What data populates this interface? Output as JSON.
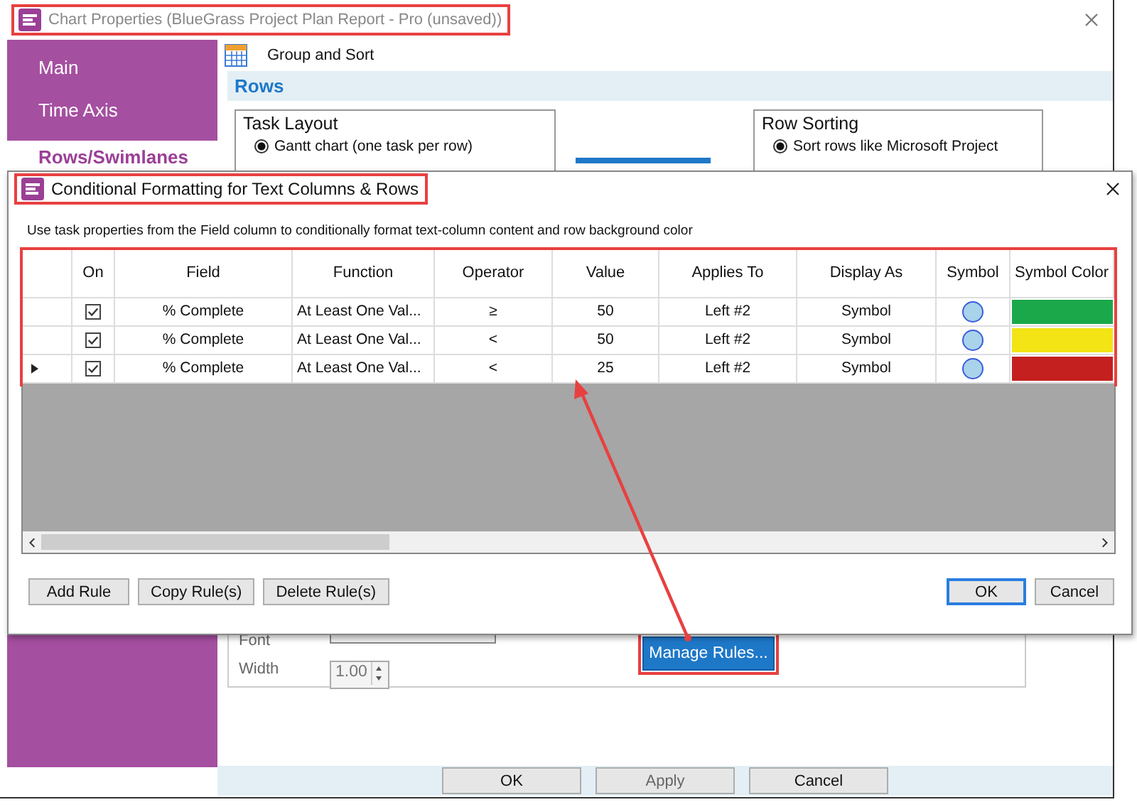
{
  "main_window": {
    "title": "Chart Properties (BlueGrass Project Plan Report - Pro (unsaved))",
    "sidebar": {
      "items": [
        {
          "label": "Main",
          "selected": false
        },
        {
          "label": "Time Axis",
          "selected": false
        },
        {
          "label": "Rows/Swimlanes",
          "selected": true
        }
      ]
    },
    "section_header": "Group and Sort",
    "band": "Rows",
    "task_layout": {
      "title": "Task Layout",
      "options": [
        {
          "label": "Gantt chart (one task per row)",
          "selected": true
        }
      ]
    },
    "row_sorting": {
      "title": "Row Sorting",
      "options": [
        {
          "label": "Sort rows like Microsoft Project",
          "selected": true
        }
      ]
    },
    "font_label": "Font",
    "width_label": "Width",
    "width_value": "1.00",
    "manage_rules_button": "Manage Rules...",
    "buttons": [
      {
        "label": "OK",
        "disabled": false
      },
      {
        "label": "Apply",
        "disabled": true
      },
      {
        "label": "Cancel",
        "disabled": false
      }
    ]
  },
  "dialog": {
    "title": "Conditional Formatting for Text Columns & Rows",
    "instructions": "Use task properties from the Field column to conditionally format text-column content and row background color",
    "columns": [
      "On",
      "Field",
      "Function",
      "Operator",
      "Value",
      "Applies To",
      "Display As",
      "Symbol",
      "Symbol Color"
    ],
    "rows": [
      {
        "current": false,
        "on": true,
        "field": "% Complete",
        "function": "At Least One Val...",
        "operator": "≥",
        "value": "50",
        "applies_to": "Left #2",
        "display_as": "Symbol",
        "color": "#1aa84a"
      },
      {
        "current": false,
        "on": true,
        "field": "% Complete",
        "function": "At Least One Val...",
        "operator": "<",
        "value": "50",
        "applies_to": "Left #2",
        "display_as": "Symbol",
        "color": "#f2e415"
      },
      {
        "current": true,
        "on": true,
        "field": "% Complete",
        "function": "At Least One Val...",
        "operator": "<",
        "value": "25",
        "applies_to": "Left #2",
        "display_as": "Symbol",
        "color": "#c42020"
      }
    ],
    "left_buttons": [
      "Add Rule",
      "Copy Rule(s)",
      "Delete Rule(s)"
    ],
    "right_buttons": [
      {
        "label": "OK",
        "default": true
      },
      {
        "label": "Cancel",
        "default": false
      }
    ]
  }
}
